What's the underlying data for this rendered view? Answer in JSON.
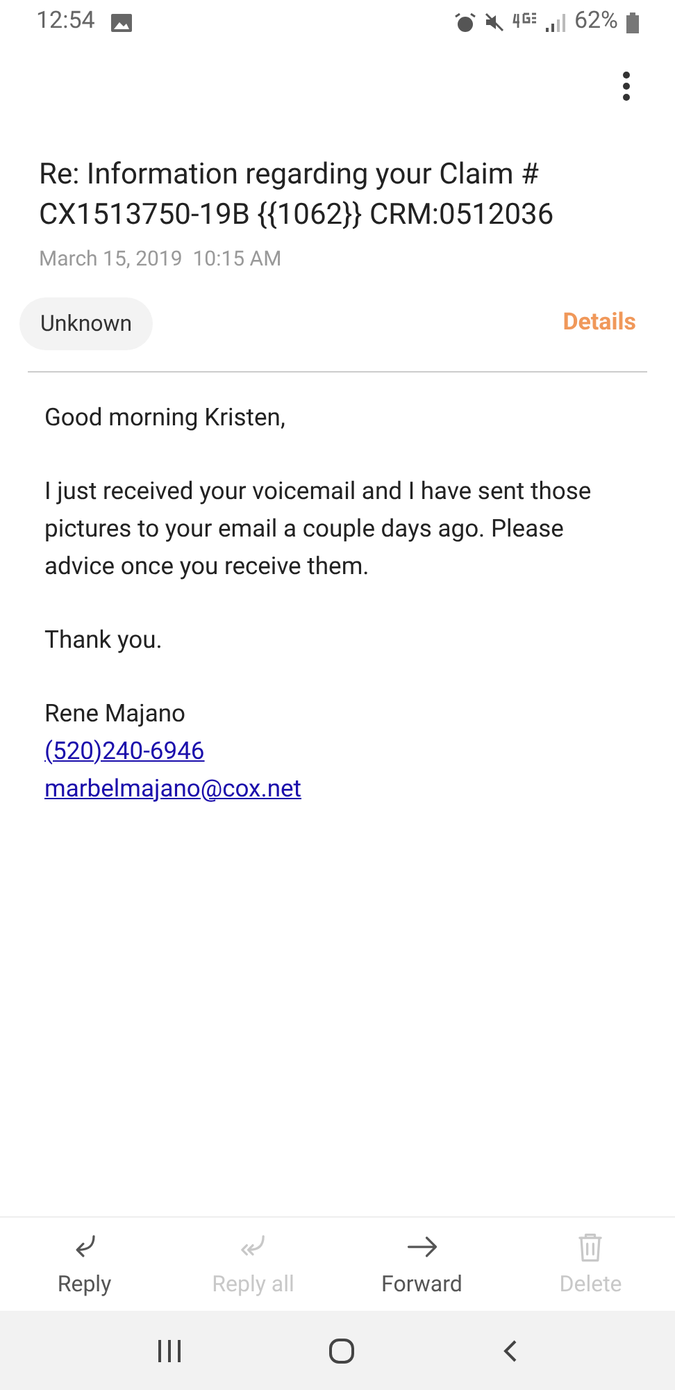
{
  "status_bar": {
    "time": "12:54",
    "battery": "62%"
  },
  "subject": "Re: Information regarding your Claim # CX1513750-19B {{1062}} CRM:0512036",
  "date": "March 15, 2019  10:15 AM",
  "sender": "Unknown",
  "details_link": "Details",
  "body": [
    {
      "kind": "text",
      "lines": [
        "Good morning Kristen,"
      ]
    },
    {
      "kind": "text",
      "lines": [
        "I just received your voicemail and I have sent those pictures to your email a couple days ago. Please advice once you receive them."
      ]
    },
    {
      "kind": "text",
      "lines": [
        "Thank you."
      ]
    },
    {
      "kind": "signature",
      "lines": [
        "Rene Majano"
      ],
      "links": [
        "(520)240-6946",
        "marbelmajano@cox.net"
      ]
    }
  ],
  "actions": [
    {
      "kind": "reply",
      "label": "Reply",
      "disabled": false
    },
    {
      "kind": "reply_all",
      "label": "Reply all",
      "disabled": true
    },
    {
      "kind": "forward",
      "label": "Forward",
      "disabled": false
    },
    {
      "kind": "delete",
      "label": "Delete",
      "disabled": true
    }
  ]
}
